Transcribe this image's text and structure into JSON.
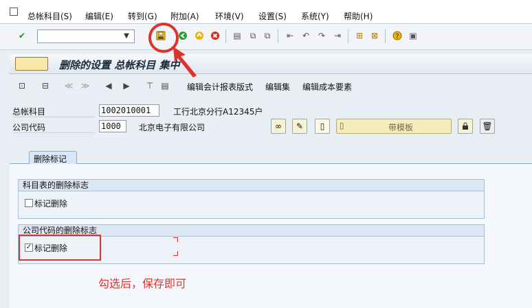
{
  "menubar": {
    "items": [
      "总帐科目(S)",
      "编辑(E)",
      "转到(G)",
      "附加(A)",
      "环境(V)",
      "设置(S)",
      "系统(Y)",
      "帮助(H)"
    ]
  },
  "toolbar": {
    "command_value": "",
    "icons": [
      "enter-icon",
      "save-icon",
      "back-icon",
      "exit-icon",
      "cancel-icon",
      "print-icon",
      "find-icon",
      "find-next-icon",
      "first-page-icon",
      "prev-page-icon",
      "next-page-icon",
      "last-page-icon",
      "create-session-icon",
      "shortcut-icon",
      "help-icon",
      "layout-icon"
    ]
  },
  "title": {
    "text": "删除的设置 总帐科目 集中"
  },
  "app_toolbar": {
    "edit_report_layout": "编辑会计报表版式",
    "edit_set": "编辑集",
    "edit_cost_element": "编辑成本要素"
  },
  "fields": {
    "gl_account_label": "总帐科目",
    "gl_account_value": "1002010001",
    "gl_account_desc": "工行北京分行A12345户",
    "company_code_label": "公司代码",
    "company_code_value": "1000",
    "company_code_desc": "北京电子有限公司",
    "template_label": "带模板"
  },
  "tab": {
    "label": "删除标记"
  },
  "groups": {
    "chart_title": "科目表的删除标志",
    "chart_checkbox_label": "标记删除",
    "chart_checked": false,
    "company_title": "公司代码的删除标志",
    "company_checkbox_label": "标记删除",
    "company_checked": true
  },
  "annotation": {
    "note": "勾选后，保存即可",
    "color": "#e0312b"
  }
}
